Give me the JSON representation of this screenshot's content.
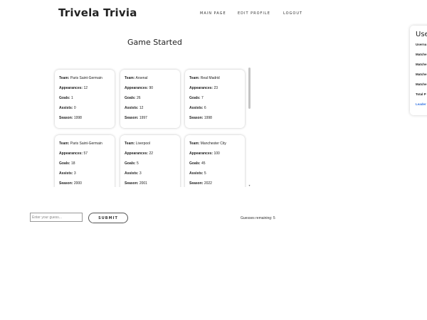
{
  "app": {
    "brand": "Trivela Trivia"
  },
  "nav": {
    "items": [
      "MAIN PAGE",
      "EDIT PROFILE",
      "LOGOUT"
    ]
  },
  "game": {
    "title": "Game Started",
    "labels": {
      "team": "Team:",
      "appearances": "Appearances:",
      "goals": "Goals:",
      "assists": "Assists:",
      "season": "Season:"
    },
    "cards": [
      {
        "team": "Paris Saint-Germain",
        "appearances": "12",
        "goals": "1",
        "assists": "0",
        "season": "1998"
      },
      {
        "team": "Arsenal",
        "appearances": "90",
        "goals": "26",
        "assists": "12",
        "season": "1997"
      },
      {
        "team": "Real Madrid",
        "appearances": "23",
        "goals": "7",
        "assists": "6",
        "season": "1998"
      },
      {
        "team": "Paris Saint-Germain",
        "appearances": "57",
        "goals": "18",
        "assists": "3",
        "season": "2000"
      },
      {
        "team": "Liverpool",
        "appearances": "22",
        "goals": "5",
        "assists": "3",
        "season": "2001"
      },
      {
        "team": "Manchester City",
        "appearances": "100",
        "goals": "45",
        "assists": "5",
        "season": "2022"
      }
    ]
  },
  "guess": {
    "placeholder": "Enter your guess...",
    "submit_label": "SUBMIT",
    "remaining_text": "Guesses remaining: 5"
  },
  "side_panel": {
    "title": "Use",
    "items": [
      "Userna",
      "Matche",
      "Matche",
      "Matche",
      "Matche",
      "Total P"
    ],
    "link": "Leader"
  }
}
